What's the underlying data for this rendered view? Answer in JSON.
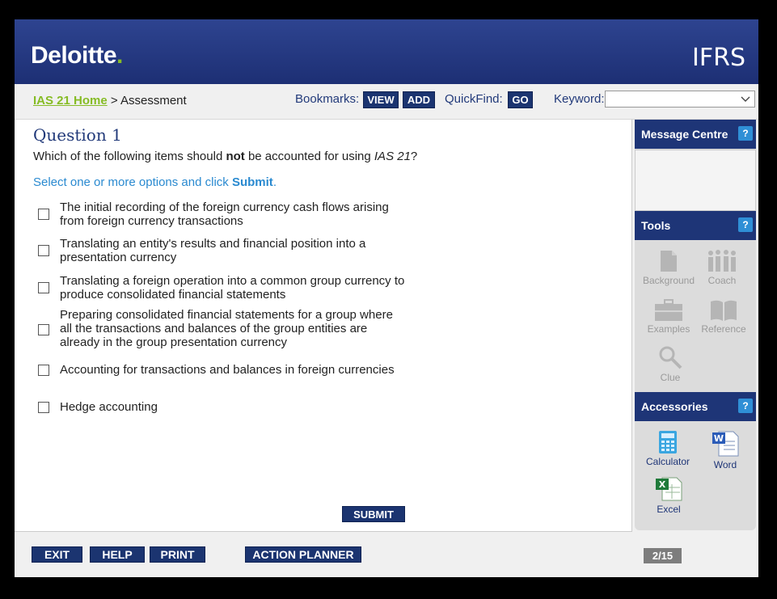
{
  "header": {
    "logo_text": "Deloitte",
    "logo_dot": ".",
    "product": "IFRS"
  },
  "nav": {
    "home_link": "IAS 21 Home",
    "separator": ">",
    "current": "Assessment",
    "bookmarks_label": "Bookmarks:",
    "view_button": "VIEW",
    "add_button": "ADD",
    "quickfind_label": "QuickFind:",
    "go_button": "GO",
    "keyword_label": "Keyword:",
    "keyword_value": ""
  },
  "question": {
    "title": "Question 1",
    "text_before": "Which of the following items should ",
    "text_bold": "not",
    "text_middle": " be accounted for using ",
    "text_italic": "IAS 21",
    "text_after": "?",
    "instruction_before": "Select one or more options and click ",
    "instruction_bold": "Submit",
    "instruction_after": ".",
    "options": [
      {
        "label": "The initial recording of the foreign currency cash flows arising\nfrom foreign currency transactions",
        "checked": false
      },
      {
        "label": "Translating an entity's results and financial position into a\npresentation currency",
        "checked": false
      },
      {
        "label": "Translating a foreign operation into a common group currency to\nproduce consolidated financial statements",
        "checked": false
      },
      {
        "label": "Preparing consolidated financial statements for a group where\nall the transactions and balances of the group entities are\nalready in the group presentation currency",
        "checked": false
      },
      {
        "label": "Accounting for transactions and balances in foreign currencies",
        "checked": false
      },
      {
        "label": "Hedge accounting",
        "checked": false
      }
    ],
    "submit_button": "SUBMIT"
  },
  "sidebar": {
    "message_centre": "Message Centre",
    "tools": "Tools",
    "accessories": "Accessories",
    "help_glyph": "?",
    "tool_items": [
      "Background",
      "Coach",
      "Examples",
      "Reference",
      "Clue"
    ],
    "accessory_items": [
      "Calculator",
      "Word",
      "Excel"
    ]
  },
  "footer": {
    "exit": "EXIT",
    "help": "HELP",
    "print": "PRINT",
    "action_planner": "ACTION PLANNER",
    "page_indicator": "2/15"
  },
  "colors": {
    "brand_navy": "#1e3577",
    "deloitte_green": "#86bc25",
    "link_blue": "#2a8ad0",
    "help_blue": "#2f8fd6"
  }
}
